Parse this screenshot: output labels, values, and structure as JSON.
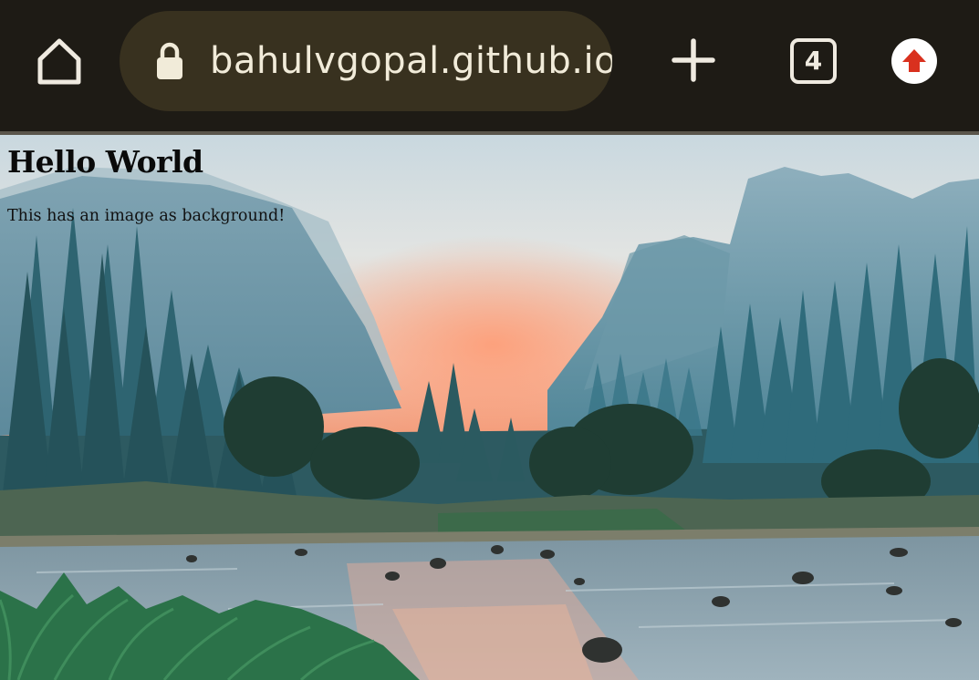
{
  "browser": {
    "url": "bahulvgopal.github.io/",
    "tab_count": "4",
    "icons": {
      "home": "home-icon",
      "lock": "lock-icon",
      "new_tab": "plus-icon",
      "tabs": "tab-switcher-icon",
      "update": "arrow-up-icon"
    },
    "colors": {
      "toolbar": "#1e1b15",
      "url_pill": "#38311f",
      "url_text": "#f1ebd9",
      "update_arrow": "#d9311e"
    }
  },
  "page": {
    "heading": "Hello World",
    "paragraph": "This has an image as background!",
    "background": "mountain valley with river at sunset"
  }
}
